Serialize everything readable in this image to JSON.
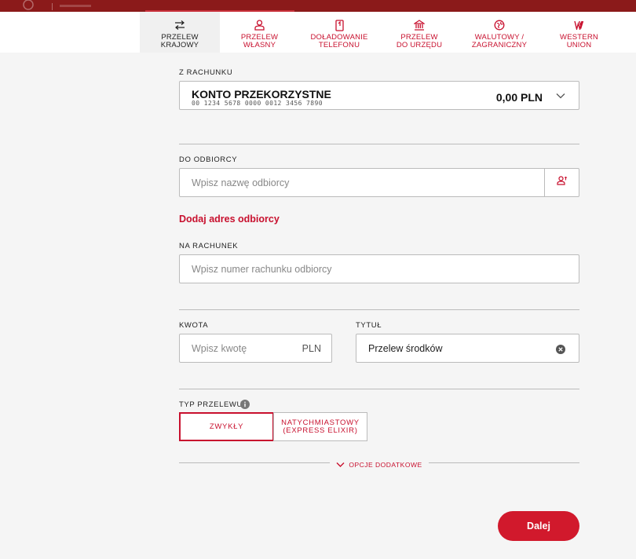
{
  "tabs": [
    {
      "label": "PRZELEW KRAJOWY",
      "icon": "transfer-arrows-icon",
      "active": true
    },
    {
      "label": "PRZELEW WŁASNY",
      "icon": "user-icon",
      "active": false
    },
    {
      "label": "DOŁADOWANIE TELEFONU",
      "icon": "phone-icon",
      "active": false
    },
    {
      "label": "PRZELEW DO URZĘDU",
      "icon": "office-building-icon",
      "active": false
    },
    {
      "label": "WALUTOWY / ZAGRANICZNY",
      "icon": "globe-icon",
      "active": false
    },
    {
      "label": "WESTERN UNION",
      "icon": "western-union-icon",
      "active": false
    }
  ],
  "from_account": {
    "label": "Z RACHUNKU",
    "name": "KONTO PRZEKORZYSTNE",
    "number": "00 1234 5678 0000 0012 3456 7890",
    "balance": "0,00 PLN"
  },
  "recipient": {
    "label": "DO ODBIORCY",
    "placeholder": "Wpisz nazwę odbiorcy",
    "add_address_link": "Dodaj adres odbiorcy"
  },
  "account_to": {
    "label": "NA RACHUNEK",
    "placeholder": "Wpisz numer rachunku odbiorcy"
  },
  "amount": {
    "label": "KWOTA",
    "placeholder": "Wpisz kwotę",
    "currency": "PLN"
  },
  "title": {
    "label": "TYTUŁ",
    "value": "Przelew środków"
  },
  "transfer_type": {
    "label": "TYP PRZELEWU",
    "options": [
      {
        "line1": "ZWYKŁY",
        "line2": "",
        "selected": true
      },
      {
        "line1": "NATYCHMIASTOWY",
        "line2": "(EXPRESS ELIXIR)",
        "selected": false
      }
    ]
  },
  "extra_options_label": "OPCJE DODATKOWE",
  "submit_label": "Dalej",
  "colors": {
    "accent": "#c8102e",
    "topbar": "#8b1a1a",
    "button": "#d1192c"
  }
}
